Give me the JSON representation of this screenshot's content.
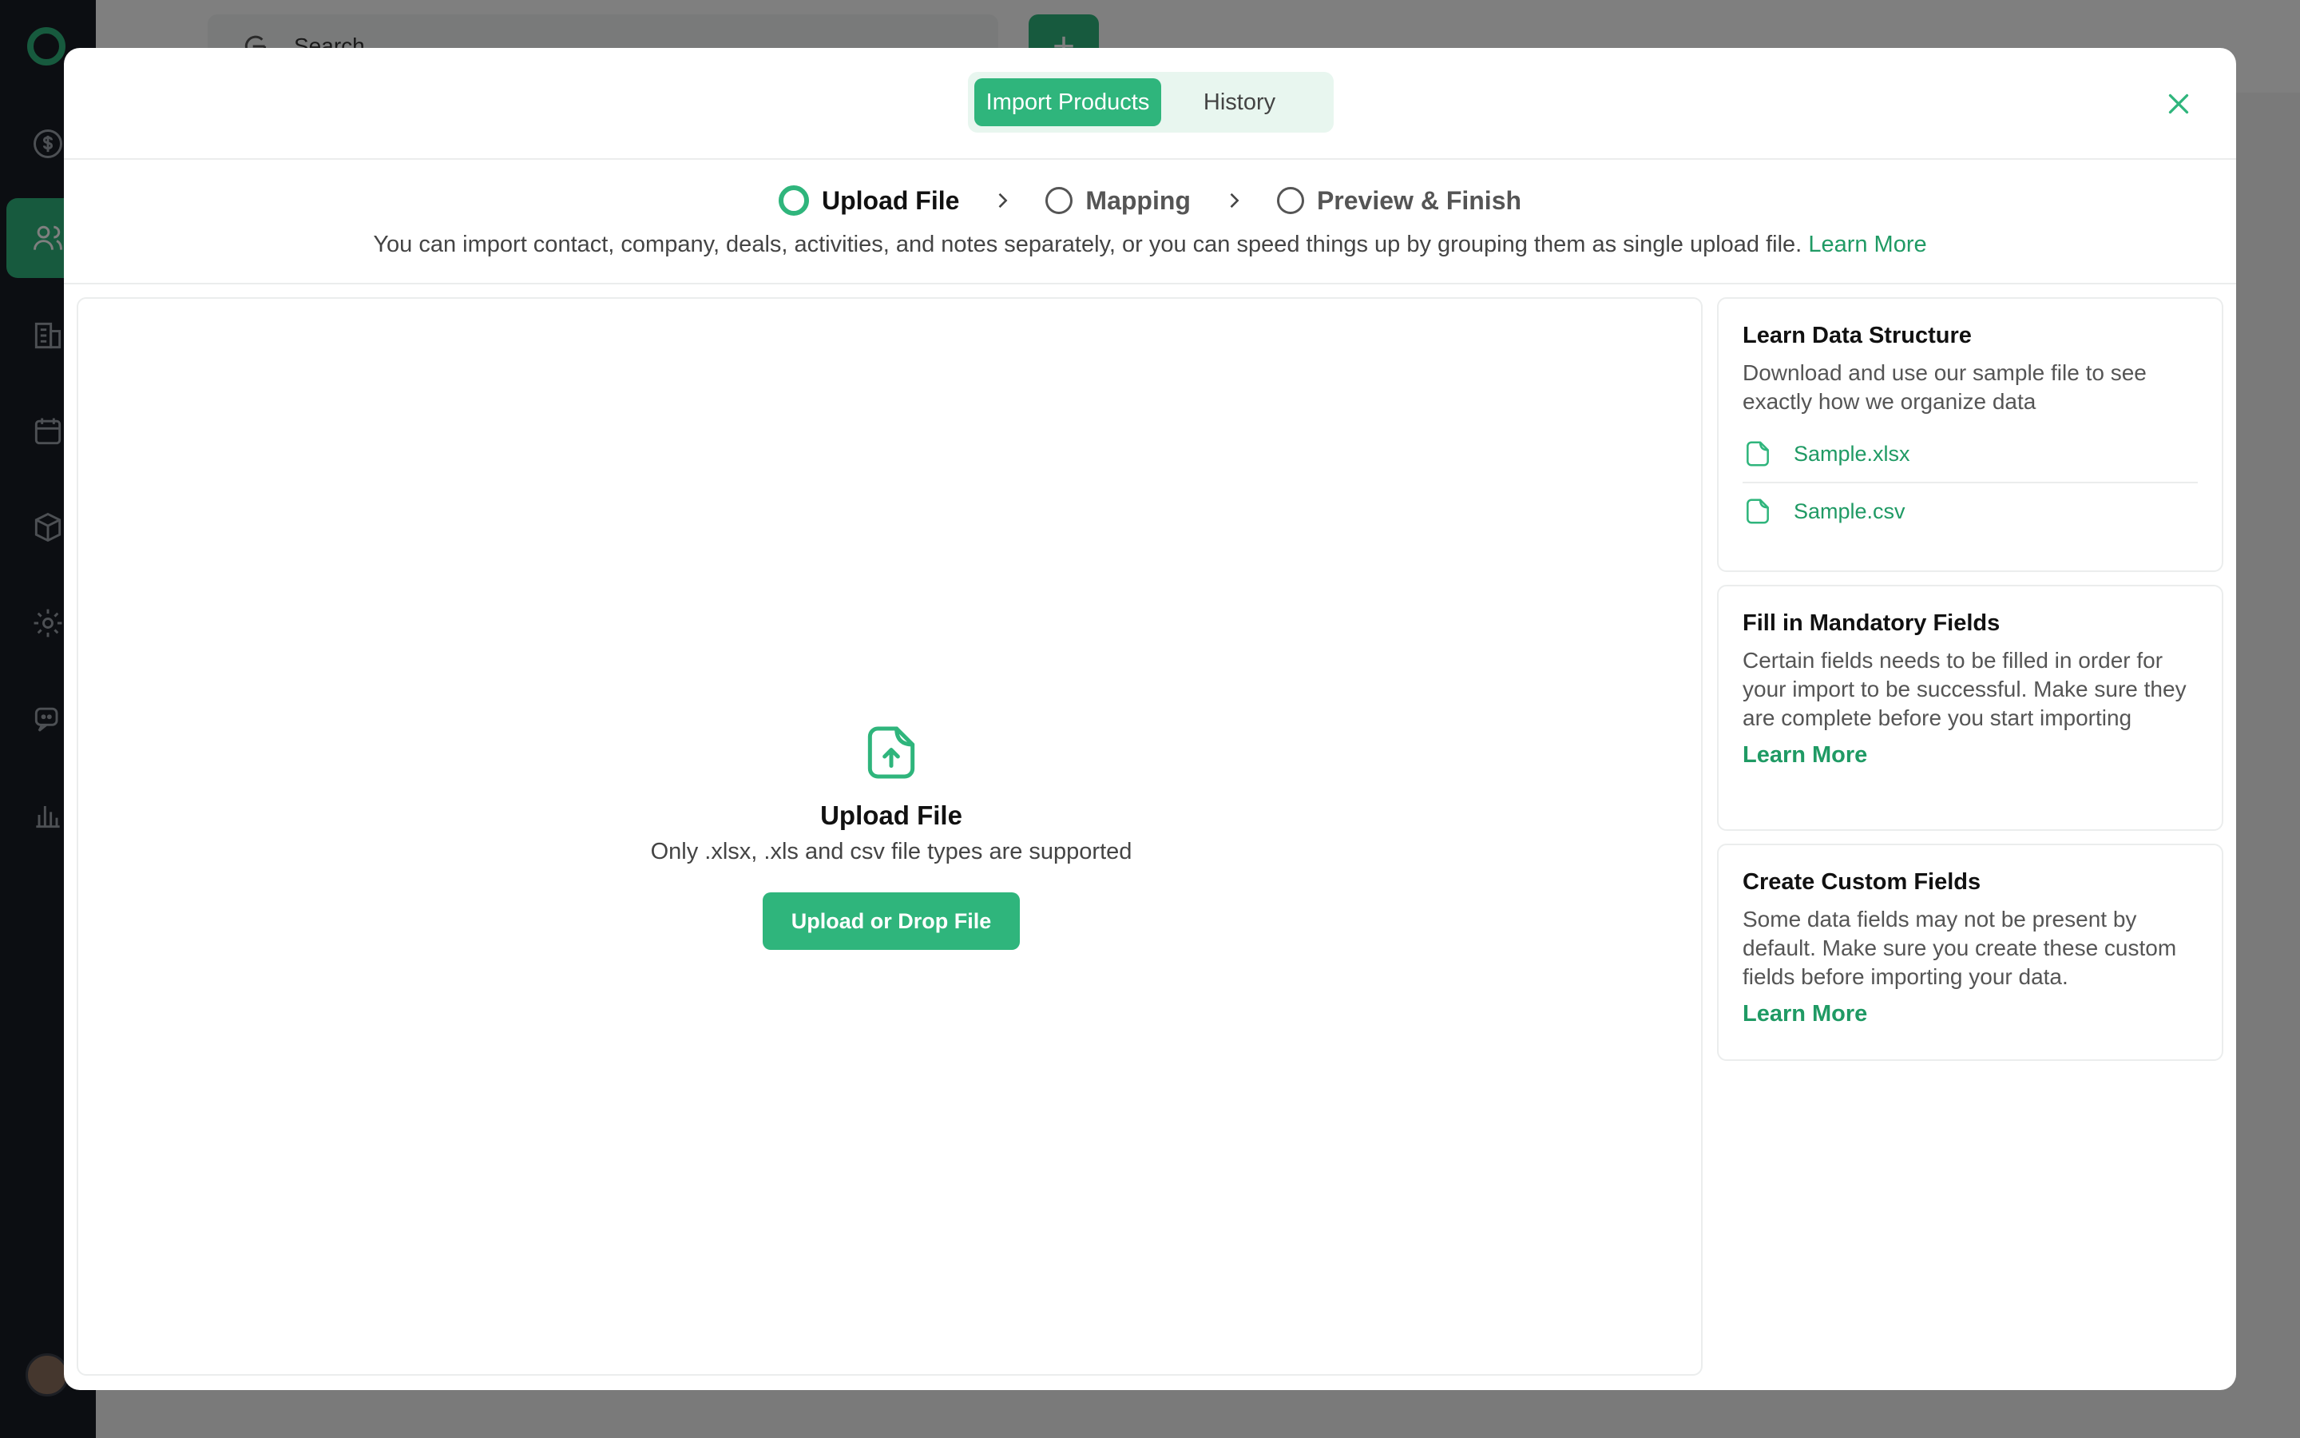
{
  "app": {
    "search_placeholder": "Search",
    "add_label": "+"
  },
  "modal": {
    "tabs": [
      {
        "label": "Import Products",
        "active": true
      },
      {
        "label": "History",
        "active": false
      }
    ],
    "steps": [
      {
        "label": "Upload File",
        "current": true
      },
      {
        "label": "Mapping",
        "current": false
      },
      {
        "label": "Preview & Finish",
        "current": false
      }
    ],
    "note": "You can import contact, company, deals, activities, and notes separately, or you can speed things up by grouping them as single upload file.",
    "note_link": "Learn More",
    "upload": {
      "title": "Upload File",
      "subtitle": "Only .xlsx, .xls and csv file types are supported",
      "button": "Upload or Drop File"
    },
    "cards": {
      "structure": {
        "title": "Learn Data Structure",
        "text": "Download and use our sample file to see exactly how we organize  data",
        "files": [
          "Sample.xlsx",
          "Sample.csv"
        ]
      },
      "mandatory": {
        "title": "Fill in Mandatory Fields",
        "text": "Certain fields needs to be filled in order for your import to be successful. Make sure they are complete before you start importing",
        "link": "Learn More"
      },
      "custom": {
        "title": "Create Custom Fields",
        "text": "Some data fields may not be present by default. Make sure you create these custom fields before importing your data.",
        "link": "Learn More"
      }
    }
  },
  "colors": {
    "accent": "#2fb57c",
    "accent_text": "#1f9a64",
    "sidebar": "#181c24"
  }
}
